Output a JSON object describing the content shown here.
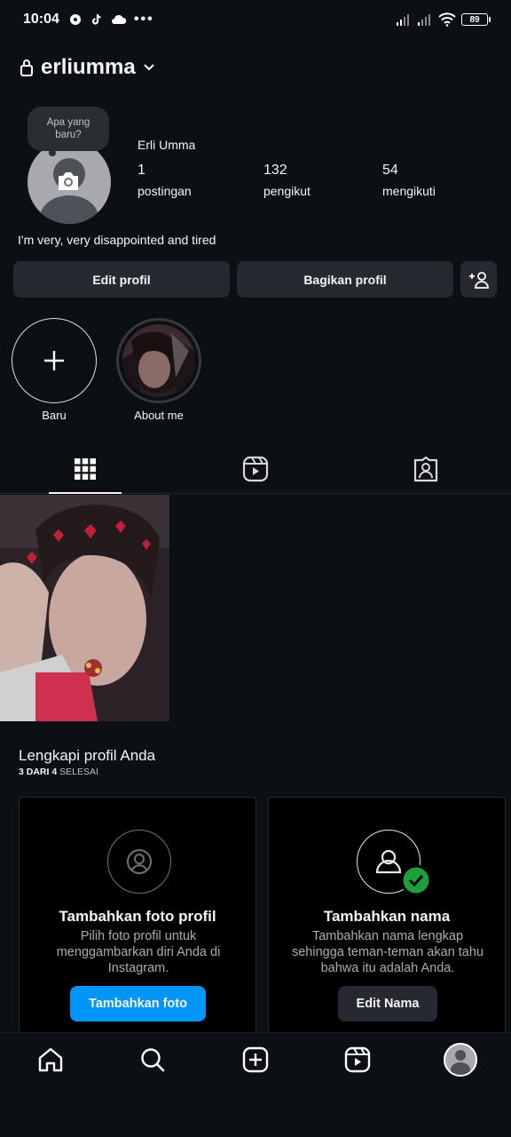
{
  "status_bar": {
    "time": "10:04",
    "battery": "89"
  },
  "header": {
    "username": "erliumma"
  },
  "profile": {
    "note_bubble": "Apa yang baru?",
    "display_name": "Erli Umma",
    "stats": [
      {
        "value": "1",
        "label": "postingan"
      },
      {
        "value": "132",
        "label": "pengikut"
      },
      {
        "value": "54",
        "label": "mengikuti"
      }
    ],
    "bio": "I'm very, very disappointed and tired"
  },
  "actions": {
    "edit_profile": "Edit profil",
    "share_profile": "Bagikan profil"
  },
  "highlights": [
    {
      "label": "Baru"
    },
    {
      "label": "About me"
    }
  ],
  "complete_profile": {
    "title": "Lengkapi profil Anda",
    "progress_done": "3 DARI 4",
    "progress_suffix": "SELESAI",
    "cards": [
      {
        "title": "Tambahkan foto profil",
        "description": "Pilih foto profil untuk menggambarkan diri Anda di Instagram.",
        "button": "Tambahkan foto"
      },
      {
        "title": "Tambahkan nama",
        "description": "Tambahkan nama lengkap sehingga teman-teman akan tahu bahwa itu adalah Anda.",
        "button": "Edit Nama"
      }
    ]
  },
  "colors": {
    "background": "#0c1014",
    "button": "#262a30",
    "primary": "#0095f6",
    "success": "#1e9e3f"
  }
}
